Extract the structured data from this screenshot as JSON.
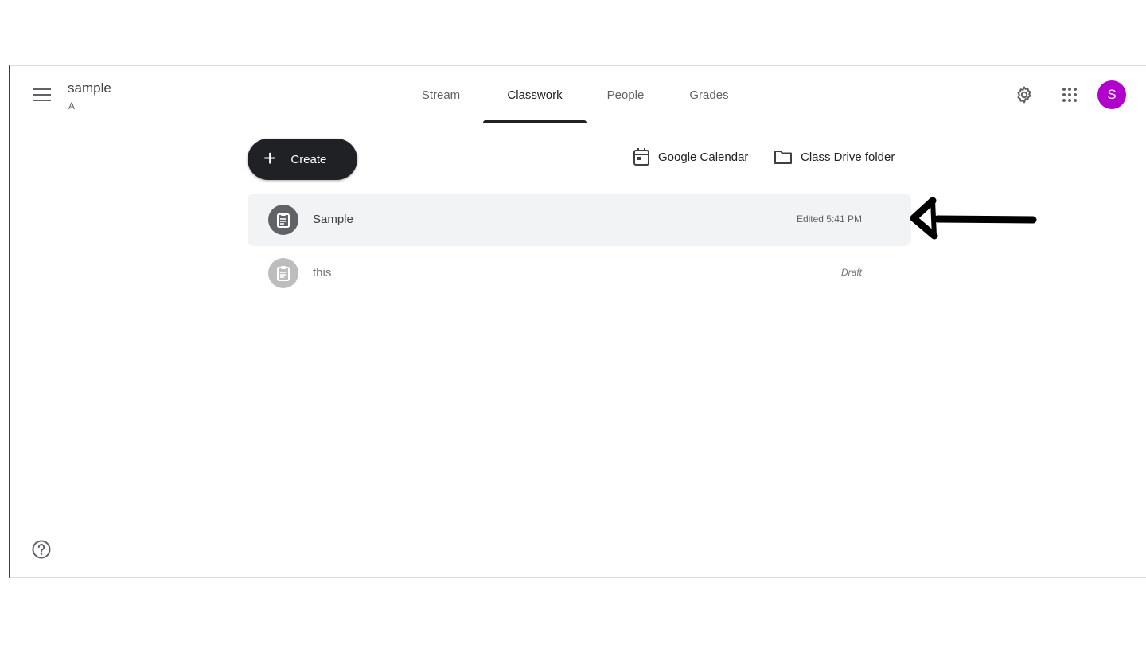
{
  "header": {
    "class_name": "sample",
    "section": "A",
    "tabs": [
      {
        "label": "Stream",
        "active": false
      },
      {
        "label": "Classwork",
        "active": true
      },
      {
        "label": "People",
        "active": false
      },
      {
        "label": "Grades",
        "active": false
      }
    ],
    "avatar_letter": "S",
    "avatar_color": "#b100cc",
    "icons": [
      "menu-icon",
      "gear-icon",
      "apps-grid-icon"
    ]
  },
  "toolbar": {
    "create_label": "Create",
    "calendar_label": "Google Calendar",
    "drive_label": "Class Drive folder"
  },
  "classwork": [
    {
      "title": "Sample",
      "meta": "Edited 5:41 PM",
      "state": "published",
      "icon": "assignment-icon"
    },
    {
      "title": "this",
      "meta": "Draft",
      "state": "draft",
      "icon": "assignment-icon"
    }
  ],
  "colors": {
    "accent_dark": "#202124",
    "row_hover": "#f1f3f4",
    "icon_published": "#5f6368",
    "icon_draft": "#bdbdbd"
  }
}
